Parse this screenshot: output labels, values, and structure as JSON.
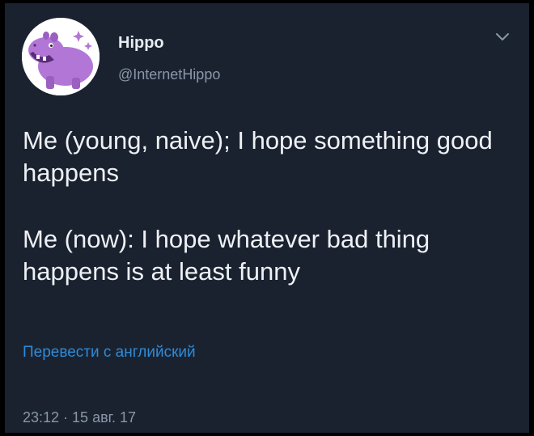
{
  "author": {
    "display_name": "Hippo",
    "handle": "@InternetHippo",
    "avatar_icon": "purple-hippo-avatar"
  },
  "menu": {
    "icon": "chevron-down-icon"
  },
  "tweet": {
    "paragraphs": [
      "Me (young, naive); I hope something good happens",
      "Me (now): I hope whatever bad thing happens is at least funny"
    ]
  },
  "translate_link": "Перевести с английский",
  "timestamp": "23:12 · 15 авг. 17",
  "colors": {
    "background": "#1a2230",
    "text": "#eef1f4",
    "muted": "#8a97a6",
    "link": "#2e8bd6",
    "avatar_accent": "#b277d6"
  }
}
